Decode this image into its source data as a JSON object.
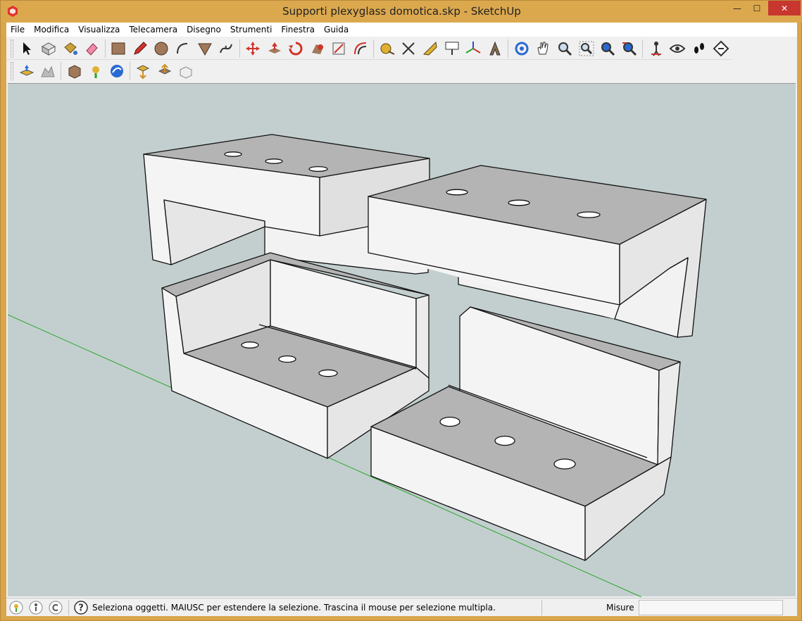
{
  "window": {
    "title": "Supporti plexyglass domotica.skp - SketchUp",
    "minimize_glyph": "—",
    "maximize_glyph": "☐",
    "close_glyph": "✕"
  },
  "menu": {
    "items": [
      {
        "label": "File"
      },
      {
        "label": "Modifica"
      },
      {
        "label": "Visualizza"
      },
      {
        "label": "Telecamera"
      },
      {
        "label": "Disegno"
      },
      {
        "label": "Strumenti"
      },
      {
        "label": "Finestra"
      },
      {
        "label": "Guida"
      }
    ]
  },
  "toolbar1": {
    "icons": [
      "select-icon",
      "make-component-icon",
      "paint-bucket-icon",
      "eraser-icon",
      "rectangle-icon",
      "pencil-icon",
      "circle-icon",
      "arc-icon",
      "polygon-icon",
      "freehand-icon",
      "move-icon",
      "push-pull-icon",
      "rotate-icon",
      "follow-me-icon",
      "scale-icon",
      "offset-icon",
      "tape-measure-icon",
      "dimension-icon",
      "protractor-icon",
      "text-icon",
      "axes-icon",
      "3d-text-icon",
      "orbit-icon",
      "pan-icon",
      "zoom-icon",
      "zoom-window-icon",
      "zoom-extents-icon",
      "previous-view-icon",
      "position-camera-icon",
      "look-around-icon",
      "walk-icon",
      "section-plane-icon"
    ]
  },
  "toolbar2": {
    "icons": [
      "add-location-icon",
      "toggle-terrain-icon",
      "photo-textures-icon",
      "preview-in-google-earth-icon",
      "get-models-icon",
      "share-model-icon",
      "share-component-icon",
      "extension-warehouse-icon"
    ]
  },
  "statusbar": {
    "message": "Seleziona oggetti. MAIUSC per estendere la selezione. Trascina il mouse per selezione multipla.",
    "measure_label": "Misure",
    "measure_value": ""
  },
  "colors": {
    "title_bar": "#dba84e",
    "viewport_bg": "#c3cfcf",
    "face_top": "#b4b4b4",
    "face_side": "#f2f2f2",
    "axis_green": "#2aa52a",
    "close_red": "#c7372f"
  }
}
